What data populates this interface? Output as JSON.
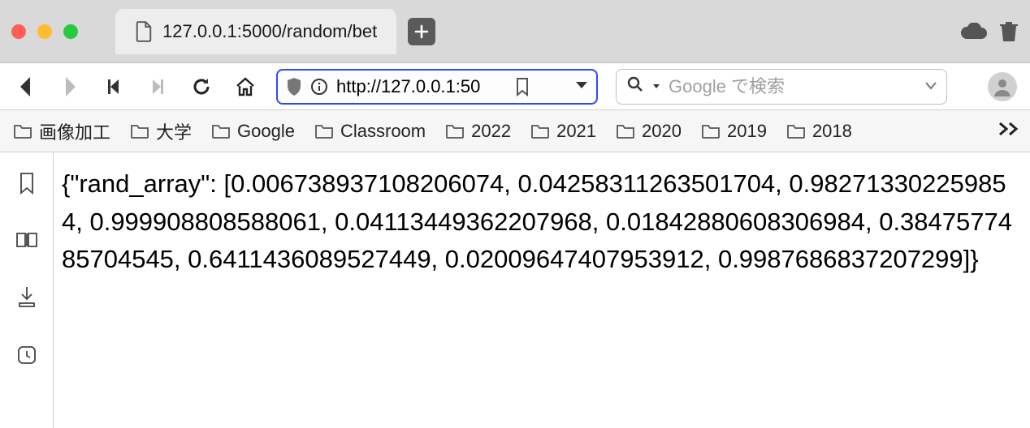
{
  "tab": {
    "title": "127.0.0.1:5000/random/bet"
  },
  "urlbar": {
    "value": "http://127.0.0.1:50"
  },
  "searchbar": {
    "placeholder": "Google で検索"
  },
  "bookmarks": [
    {
      "label": "画像加工"
    },
    {
      "label": "大学"
    },
    {
      "label": "Google"
    },
    {
      "label": "Classroom"
    },
    {
      "label": "2022"
    },
    {
      "label": "2021"
    },
    {
      "label": "2020"
    },
    {
      "label": "2019"
    },
    {
      "label": "2018"
    }
  ],
  "page_text": "{\"rand_array\": [0.006738937108206074, 0.04258311263501704, 0.982713302259854, 0.999908808588061, 0.04113449362207968, 0.01842880608306984, 0.3847577485704545, 0.6411436089527449, 0.02009647407953912, 0.9987686837207299]}"
}
